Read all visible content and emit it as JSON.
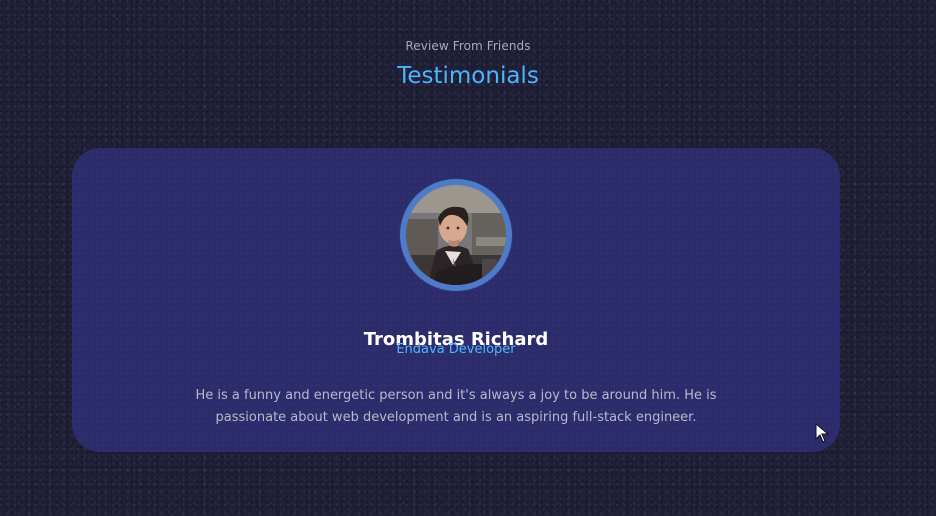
{
  "section": {
    "subtitle": "Review From Friends",
    "title": "Testimonials"
  },
  "testimonial": {
    "name": "Trombitas Richard",
    "role": "Endava Developer",
    "review": "He is a funny and energetic person and it's always a joy to be around him. He is passionate about web development and is an aspiring full-stack engineer."
  },
  "colors": {
    "background": "#1f1f38",
    "card": "#2c2c6c",
    "accent": "#4db5ff",
    "text_light": "#ffffff",
    "text_muted": "#b9b9cc"
  },
  "icons": {
    "cursor": "mouse-pointer-icon"
  }
}
